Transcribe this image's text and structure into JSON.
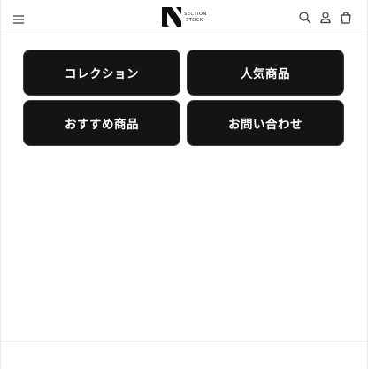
{
  "header": {
    "logo_line1": "SECTION",
    "logo_line2": "STOCK",
    "icons": [
      "hamburger-menu-icon",
      "search-icon",
      "account-icon",
      "cart-icon"
    ]
  },
  "tiles": [
    {
      "label": "コレクション"
    },
    {
      "label": "人気商品"
    },
    {
      "label": "おすすめ商品"
    },
    {
      "label": "お問い合わせ"
    }
  ],
  "colors": {
    "tile_background": "#141414",
    "tile_text": "#ffffff",
    "divider": "#ececec",
    "icon": "#333333"
  }
}
